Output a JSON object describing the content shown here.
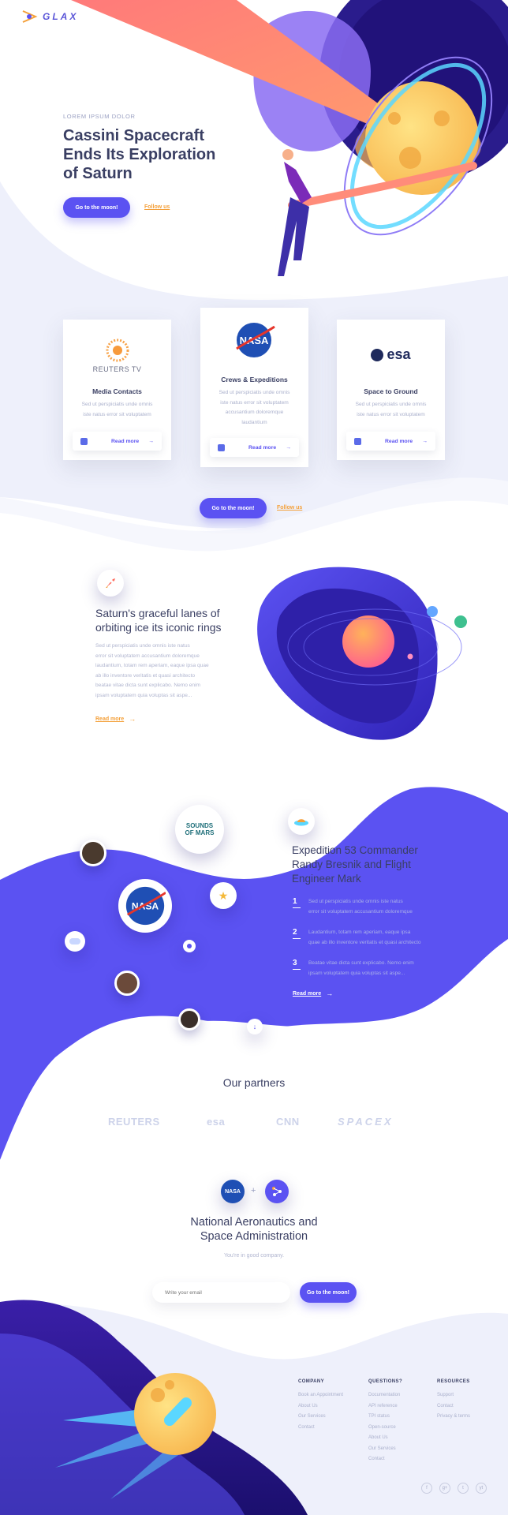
{
  "brand": {
    "name": "GLAX"
  },
  "hero": {
    "eyebrow": "LOREM IPSUM DOLOR",
    "title_lines": [
      "Cassini Spacecraft",
      "Ends Its Exploration",
      "of Saturn"
    ],
    "cta_primary": "Go to the moon!",
    "cta_secondary": "Follow us"
  },
  "cards": [
    {
      "logo": "REUTERS TV",
      "title": "Media Contacts",
      "desc": "Sed ut perspiciatis unde omnis iste natus error sit voluptatem",
      "action": "Read more"
    },
    {
      "logo": "NASA",
      "title": "Crews & Expeditions",
      "desc": "Sed ut perspiciatis unde omnis iste natus error sit voluptatem accusantium doloremque laudantium",
      "action": "Read more"
    },
    {
      "logo": "esa",
      "title": "Space to Ground",
      "desc": "Sed ut perspiciatis unde omnis iste natus error sit voluptatem",
      "action": "Read more"
    }
  ],
  "cta_row": {
    "primary": "Go to the moon!",
    "secondary": "Follow us"
  },
  "saturn": {
    "title_lines": [
      "Saturn's graceful lanes of",
      "orbiting ice its iconic rings"
    ],
    "body_lines": [
      "Sed ut perspiciatis unde omnis iste natus",
      "error sit voluptatem accusantium doloremque",
      "laudantium, totam rem aperiam, eaque ipsa quae",
      "ab illo inventore veritatis et quasi architecto",
      "beatae vitae dicta sunt explicabo. Nemo enim",
      "ipsam voluptatem quia voluptas sit aspe..."
    ],
    "link": "Read more"
  },
  "expedition": {
    "title_lines": [
      "Expedition 53 Commander",
      "Randy Bresnik and Flight",
      "Engineer Mark"
    ],
    "items": [
      {
        "num": "1",
        "lines": [
          "Sed ut perspiciatis unde omnis iste natus",
          "error sit voluptatem accusantium doloremque"
        ]
      },
      {
        "num": "2",
        "lines": [
          "Laudantium, totam rem aperiam, eaque ipsa",
          "quae ab illo inventore veritatis et quasi architecto"
        ]
      },
      {
        "num": "3",
        "lines": [
          "Beatae vitae dicta sunt explicabo. Nemo enim",
          "ipsam voluptatem quia voluptas sit aspe..."
        ]
      }
    ],
    "link": "Read more",
    "badge": "SOUNDS OF MARS"
  },
  "partners": {
    "title": "Our partners",
    "logos": [
      "REUTERS",
      "esa",
      "CNN",
      "SPACEX"
    ]
  },
  "nasa": {
    "title_lines": [
      "National Aeronautics and",
      "Space Administration"
    ],
    "subtitle": "You're in good company.",
    "email_placeholder": "Write your email",
    "cta": "Go to the moon!"
  },
  "footer": {
    "columns": [
      {
        "head": "COMPANY",
        "links": [
          "Book an Appointment",
          "About Us",
          "Our Services",
          "Contact"
        ]
      },
      {
        "head": "QUESTIONS?",
        "links": [
          "Documentation",
          "API reference",
          "TPI status",
          "Open-source",
          "About Us",
          "Our Services",
          "Contact"
        ]
      },
      {
        "head": "RESOURCES",
        "links": [
          "Support",
          "Contact",
          "Privacy & terms"
        ]
      }
    ],
    "social": [
      "f",
      "g+",
      "t",
      "yt"
    ]
  },
  "colors": {
    "primary": "#5b52f2",
    "accent": "#f4a03a",
    "text": "#3a3f63"
  }
}
